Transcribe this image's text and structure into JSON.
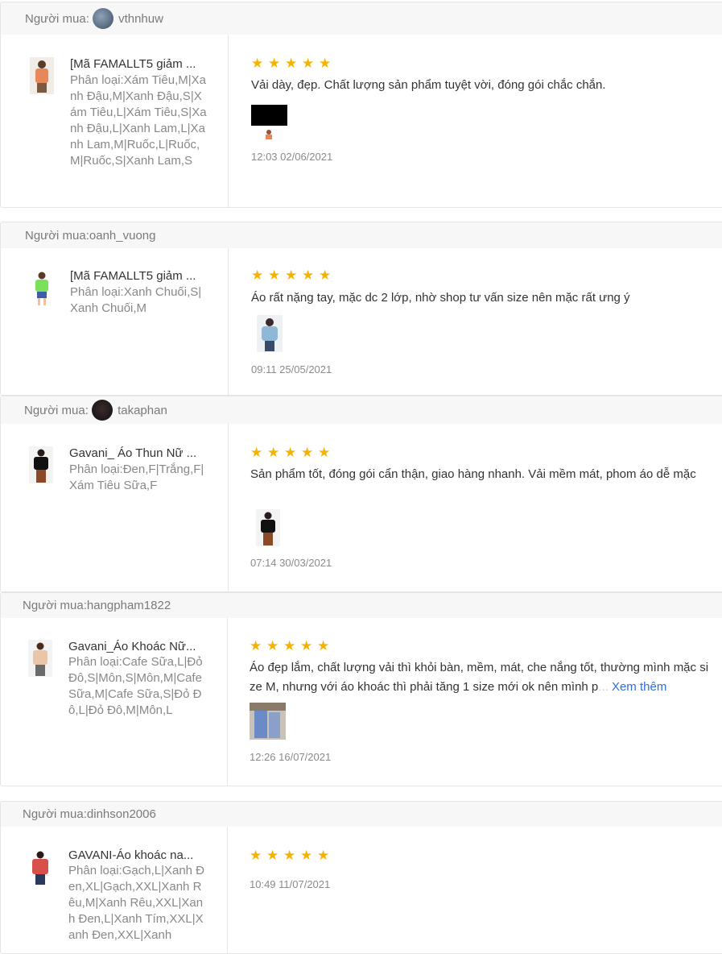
{
  "reviews": [
    {
      "buyer_label": "Người mua: ",
      "username": "vthnhuw",
      "has_avatar": true,
      "product_name": "[Mã FAMALLT5 giảm ...",
      "variant": "Phân loại:Xám Tiêu,M|Xanh Đậu,M|Xanh Đậu,S|Xám Tiêu,L|Xám Tiêu,S|Xanh Đậu,L|Xanh Lam,L|Xanh Lam,M|Ruốc,L|Ruốc,M|Ruốc,S|Xanh Lam,S",
      "stars": 5,
      "text": "Vải dày, đẹp. Chất lượng sản phẩm tuyệt vời, đóng gói chắc chắn.",
      "date": "12:03 02/06/2021"
    },
    {
      "buyer_label": "Người mua:",
      "username": "oanh_vuong",
      "has_avatar": false,
      "product_name": "[Mã FAMALLT5 giảm ...",
      "variant": "Phân loại:Xanh Chuối,S|Xanh Chuối,M",
      "stars": 5,
      "text": "Áo rất nặng tay, mặc dc 2 lớp, nhờ shop tư vấn size nên mặc rất ưng ý",
      "date": "09:11 25/05/2021"
    },
    {
      "buyer_label": "Người mua: ",
      "username": "takaphan",
      "has_avatar": true,
      "product_name": "Gavani_ Áo Thun Nữ ...",
      "variant": "Phân loại:Đen,F|Trắng,F|Xám Tiêu Sữa,F",
      "stars": 5,
      "text": "Sản phẩm tốt, đóng gói cẩn thận, giao hàng nhanh. Vải mềm mát, phom áo dễ mặc",
      "date": "07:14 30/03/2021"
    },
    {
      "buyer_label": "Người mua:",
      "username": "hangpham1822",
      "has_avatar": false,
      "product_name": "Gavani_Áo Khoác Nữ...",
      "variant": "Phân loại:Cafe Sữa,L|Đỏ Đô,S|Môn,S|Môn,M|Cafe Sữa,M|Cafe Sữa,S|Đỏ Đô,L|Đỏ Đô,M|Môn,L",
      "stars": 5,
      "text": "Áo đẹp lắm, chất lượng vải thì khỏi bàn, mềm, mát, che nắng tốt, thường mình mặc size M, nhưng với áo khoác thì phải tăng 1 size mới ok nên mình p",
      "more_label": "Xem thêm",
      "date": "12:26 16/07/2021"
    },
    {
      "buyer_label": "Người mua:",
      "username": "dinhson2006",
      "has_avatar": false,
      "product_name": "GAVANI-Áo khoác na...",
      "variant": "Phân loại:Gạch,L|Xanh Đen,XL|Gạch,XXL|Xanh Rêu,M|Xanh Rêu,XXL|Xanh Đen,L|Xanh Tím,XXL|Xanh Đen,XXL|Xanh",
      "stars": 5,
      "text": "",
      "date": "10:49 11/07/2021"
    }
  ],
  "colors": {
    "star": "#f5b301",
    "link": "#2f6ed8"
  }
}
